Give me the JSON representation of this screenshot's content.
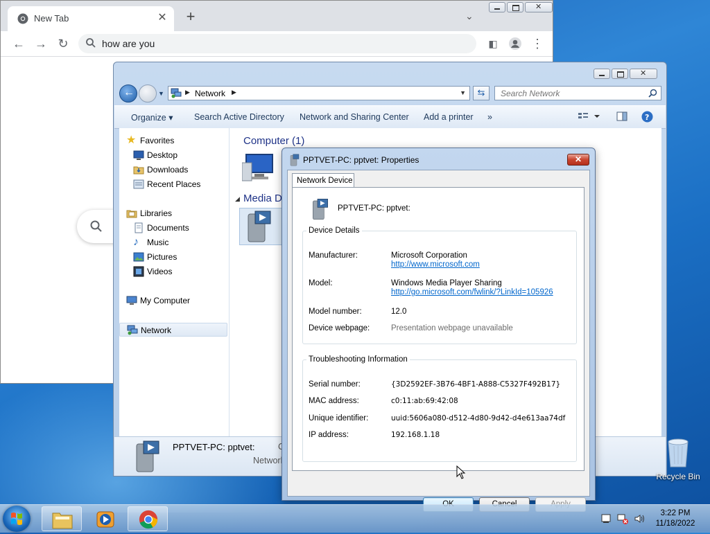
{
  "chrome": {
    "tab_title": "New Tab",
    "new_tab_label": "+",
    "omnibox_text": "how are you"
  },
  "explorer": {
    "breadcrumb": "Network",
    "search_placeholder": "Search Network",
    "commands": [
      "Organize",
      "Search Active Directory",
      "Network and Sharing Center",
      "Add a printer",
      "»"
    ],
    "nav": {
      "favorites": "Favorites",
      "desktop": "Desktop",
      "downloads": "Downloads",
      "recent": "Recent Places",
      "libraries": "Libraries",
      "documents": "Documents",
      "music": "Music",
      "pictures": "Pictures",
      "videos": "Videos",
      "my_computer": "My Computer",
      "network": "Network"
    },
    "groups": {
      "computer": "Computer (1)",
      "media": "Media D"
    },
    "details": {
      "name": "PPTVET-PC: pptvet:",
      "category": "Network",
      "c": "C"
    }
  },
  "dialog": {
    "title": "PPTVET-PC: pptvet: Properties",
    "tab": "Network Device",
    "device_name": "PPTVET-PC: pptvet:",
    "device_details_legend": "Device Details",
    "manufacturer_label": "Manufacturer:",
    "manufacturer_value": "Microsoft Corporation",
    "manufacturer_url": "http://www.microsoft.com",
    "model_label": "Model:",
    "model_value": "Windows Media Player Sharing",
    "model_url": "http://go.microsoft.com/fwlink/?LinkId=105926",
    "model_number_label": "Model number:",
    "model_number_value": "12.0",
    "webpage_label": "Device webpage:",
    "webpage_value": "Presentation webpage unavailable",
    "troubleshooting_legend": "Troubleshooting Information",
    "serial_label": "Serial number:",
    "serial_value": "{3D2592EF-3B76-4BF1-A888-C5327F492B17}",
    "mac_label": "MAC address:",
    "mac_value": "c0:11:ab:69:42:08",
    "uid_label": "Unique identifier:",
    "uid_value": "uuid:5606a080-d512-4d80-9d42-d4e613aa74df",
    "ip_label": "IP address:",
    "ip_value": "192.168.1.18",
    "ok": "OK",
    "cancel": "Cancel",
    "apply": "Apply"
  },
  "desktop": {
    "recycle_bin": "Recycle Bin"
  },
  "taskbar": {
    "time": "3:22 PM",
    "date": "11/18/2022"
  },
  "icons": {
    "chrome_favicon": "chrome-icon",
    "search": "search-icon",
    "network": "network-icon",
    "device": "media-device-icon"
  },
  "colors": {
    "explorer_frame": "#b9cfe9",
    "link": "#0066cc",
    "group_header": "#1e3287",
    "close_red": "#c9452f"
  }
}
